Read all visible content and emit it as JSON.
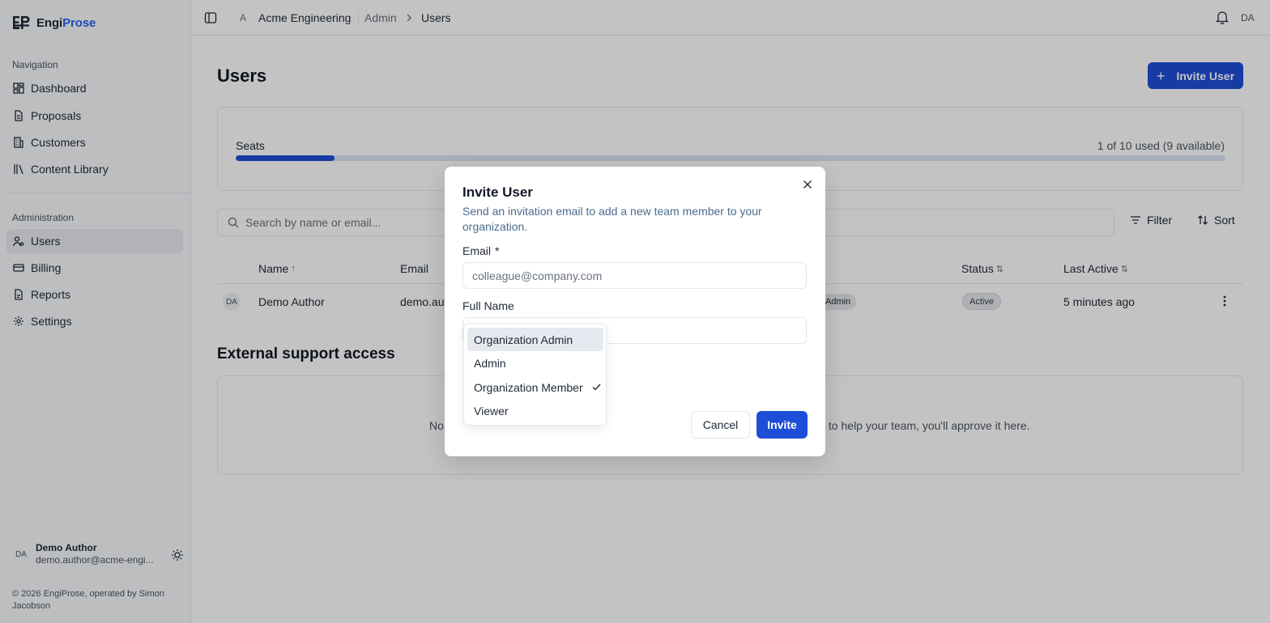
{
  "brand": {
    "name_prefix": "Engi",
    "name_accent": "Prose"
  },
  "sidebar": {
    "navigation_heading": "Navigation",
    "nav_items": [
      {
        "label": "Dashboard",
        "icon": "dashboard-icon"
      },
      {
        "label": "Proposals",
        "icon": "document-icon"
      },
      {
        "label": "Customers",
        "icon": "building-icon"
      },
      {
        "label": "Content Library",
        "icon": "library-icon"
      }
    ],
    "admin_heading": "Administration",
    "admin_items": [
      {
        "label": "Users",
        "icon": "users-icon",
        "active": true
      },
      {
        "label": "Billing",
        "icon": "credit-card-icon"
      },
      {
        "label": "Reports",
        "icon": "report-icon"
      },
      {
        "label": "Settings",
        "icon": "gear-icon"
      }
    ],
    "user": {
      "initials": "DA",
      "name": "Demo Author",
      "email": "demo.author@acme-engi..."
    },
    "copyright": "© 2026 EngiProse, operated by Simon Jacobson"
  },
  "topbar": {
    "org_initial": "A",
    "breadcrumb": [
      "Acme Engineering",
      "Admin",
      "Users"
    ],
    "avatar_initials": "DA"
  },
  "main": {
    "title": "Users",
    "invite_button": "Invite User",
    "seats": {
      "label": "Seats",
      "count_text": "1 of 10 used (9 available)",
      "used": 1,
      "total": 10
    },
    "search_placeholder": "Search by name or email...",
    "filter_label": "Filter",
    "sort_label": "Sort",
    "columns": {
      "name": "Name",
      "email": "Email",
      "status": "Status",
      "last_active": "Last Active"
    },
    "rows": [
      {
        "initials": "DA",
        "name": "Demo Author",
        "email": "demo.aut",
        "role": "Admin",
        "status": "Active",
        "last_active": "5 minutes ago"
      }
    ],
    "external": {
      "title": "External support access",
      "text_left": "No",
      "text_right": "s to help your team, you'll approve it here."
    }
  },
  "modal": {
    "title": "Invite User",
    "description": "Send an invitation email to add a new team member to your organization.",
    "email_label": "Email",
    "required_mark": "*",
    "email_placeholder": "colleague@company.com",
    "email_value": "",
    "fullname_label": "Full Name",
    "fullname_value": "",
    "cancel": "Cancel",
    "invite": "Invite"
  },
  "role_dropdown": {
    "options": [
      "Organization Admin",
      "Admin",
      "Organization Member",
      "Viewer"
    ],
    "selected": "Organization Member",
    "highlighted": "Organization Admin"
  },
  "colors": {
    "accent": "#1d4ed8",
    "brand_accent": "#2563eb",
    "overlay": "rgba(0,0,0,0.235)"
  }
}
